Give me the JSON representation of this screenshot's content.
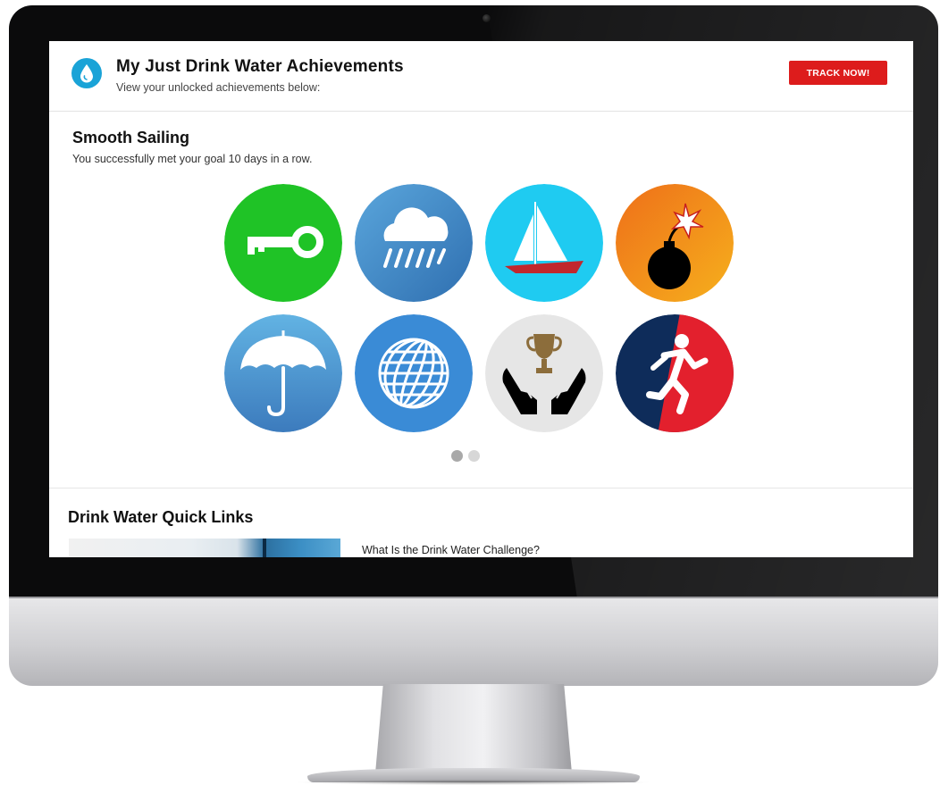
{
  "header": {
    "title": "My Just Drink Water Achievements",
    "subtitle": "View your unlocked achievements below:",
    "track_button": "TRACK NOW!"
  },
  "achievement": {
    "title": "Smooth Sailing",
    "description": "You successfully met your goal 10 days in a row."
  },
  "badges": [
    {
      "icon": "key-icon",
      "color": "#1fc326"
    },
    {
      "icon": "rain-cloud-icon",
      "color": "#4591c9"
    },
    {
      "icon": "sailboat-icon",
      "color": "#1fcbf1"
    },
    {
      "icon": "bomb-icon",
      "color": "#f07c1c"
    },
    {
      "icon": "umbrella-icon",
      "color": "#4a90c6"
    },
    {
      "icon": "globe-icon",
      "color": "#3a8bd6"
    },
    {
      "icon": "trophy-hands-icon",
      "color": "#e6e6e6"
    },
    {
      "icon": "runner-icon",
      "color": "#0e2c5a"
    }
  ],
  "carousel": {
    "pages": 2,
    "active_page": 1
  },
  "quick_links": {
    "title": "Drink Water Quick Links",
    "items": [
      {
        "label": "What Is the Drink Water Challenge?"
      }
    ]
  }
}
